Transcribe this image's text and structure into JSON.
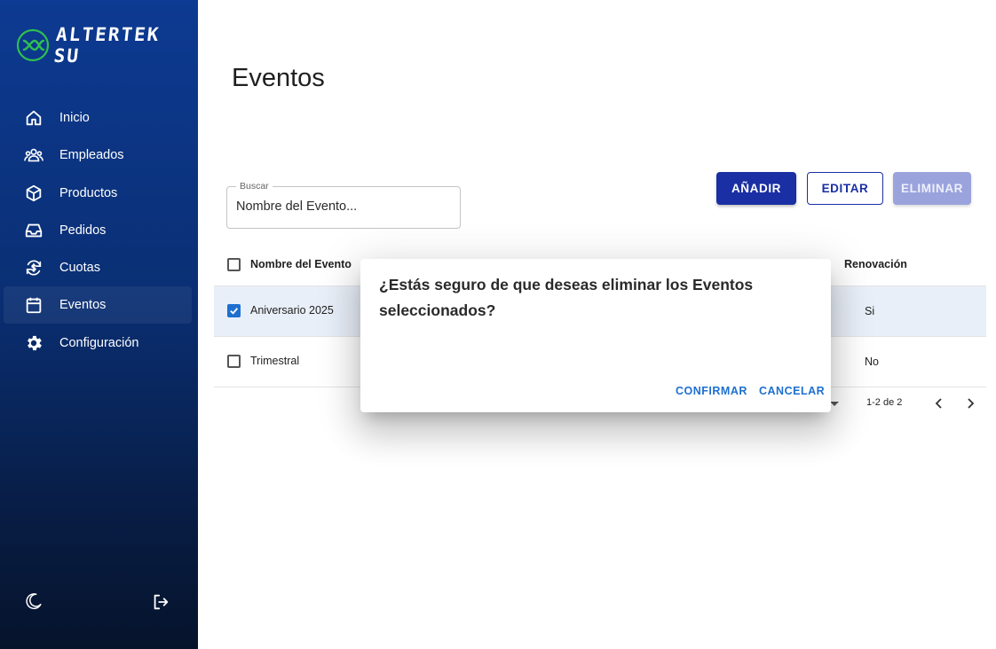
{
  "brand": {
    "name": "ALTERTEK SU",
    "accent": "#2fbf4f"
  },
  "sidebar": {
    "items": [
      {
        "label": "Inicio",
        "icon": "home-icon"
      },
      {
        "label": "Empleados",
        "icon": "people-icon"
      },
      {
        "label": "Productos",
        "icon": "cube-icon"
      },
      {
        "label": "Pedidos",
        "icon": "inbox-icon"
      },
      {
        "label": "Cuotas",
        "icon": "dollar-refresh-icon"
      },
      {
        "label": "Eventos",
        "icon": "calendar-icon",
        "active": true
      },
      {
        "label": "Configuración",
        "icon": "gear-icon"
      }
    ],
    "footer": {
      "theme_icon": "moon-icon",
      "logout_icon": "logout-icon"
    }
  },
  "page": {
    "title": "Eventos"
  },
  "search": {
    "label": "Buscar",
    "placeholder": "Nombre del Evento..."
  },
  "toolbar": {
    "add_label": "AÑADIR",
    "edit_label": "EDITAR",
    "delete_label": "ELIMINAR"
  },
  "table": {
    "headers": {
      "name": "Nombre del Evento",
      "renewal": "Renovación"
    },
    "rows": [
      {
        "name": "Aniversario 2025",
        "renewal": "Si",
        "checked": true
      },
      {
        "name": "Trimestral",
        "renewal": "No",
        "checked": false
      }
    ]
  },
  "pagination": {
    "range": "1-2 de 2"
  },
  "dialog": {
    "title": "¿Estás seguro de que deseas eliminar los Eventos seleccionados?",
    "confirm_label": "CONFIRMAR",
    "cancel_label": "CANCELAR"
  },
  "colors": {
    "primary": "#1a2fa3",
    "primary_disabled": "#9aa3dc",
    "checkbox": "#1e6fd0",
    "dialog_action": "#1e6fd0",
    "sidebar_top": "#0d3a92",
    "sidebar_bottom": "#06132b",
    "selected_row": "#e9eff8"
  }
}
